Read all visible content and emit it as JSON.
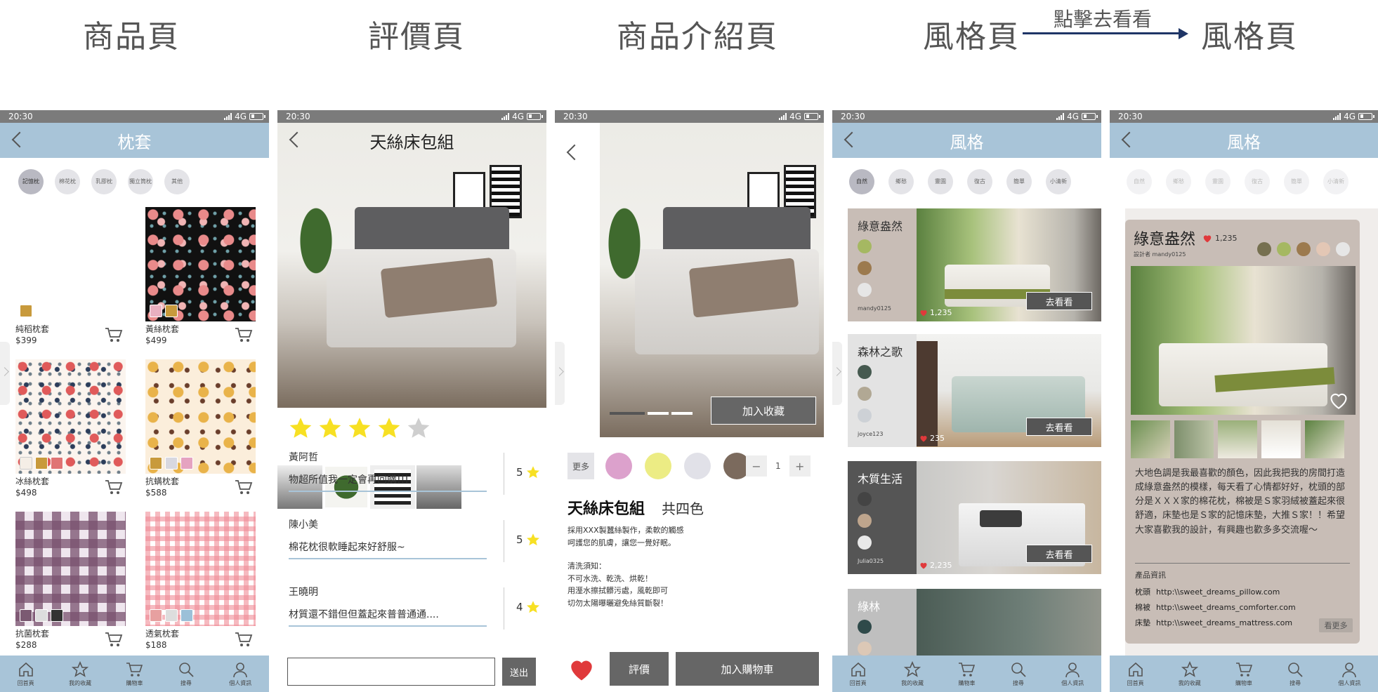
{
  "headers": {
    "product_page": "商品頁",
    "review_page": "評價頁",
    "intro_page": "商品介紹頁",
    "style_page": "風格頁",
    "style_page_2": "風格頁",
    "flow_label": "點擊去看看"
  },
  "status": {
    "time": "20:30",
    "network": "4G"
  },
  "nav": [
    "回首頁",
    "我的收藏",
    "購物車",
    "搜尋",
    "個人資訊"
  ],
  "screen1": {
    "title": "枕套",
    "chips": [
      "記憶枕",
      "棉花枕",
      "乳膠枕",
      "獨立筒枕",
      "其他"
    ],
    "products": [
      {
        "name": "純稻枕套",
        "price": "$399"
      },
      {
        "name": "黃絲枕套",
        "price": "$499"
      },
      {
        "name": "冰絲枕套",
        "price": "$498"
      },
      {
        "name": "抗螨枕套",
        "price": "$588"
      },
      {
        "name": "抗菌枕套",
        "price": "$288"
      },
      {
        "name": "透氣枕套",
        "price": "$188"
      }
    ]
  },
  "screen2": {
    "title": "天絲床包組",
    "rating_stars": 4,
    "reviews": [
      {
        "name": "黃阿哲",
        "text": "物超所值我一定會再回購!!!",
        "score": "5"
      },
      {
        "name": "陳小美",
        "text": "棉花枕很軟睡起來好舒服~",
        "score": "5"
      },
      {
        "name": "王曉明",
        "text": "材質還不錯但但蓋起來普普通通....",
        "score": "4"
      }
    ],
    "send_label": "送出"
  },
  "screen3": {
    "fav_label": "加入收藏",
    "more_label": "更多",
    "colors": [
      "#dca1cc",
      "#ecec84",
      "#e1e1e8",
      "#7b6a5d"
    ],
    "qty": "1",
    "minus": "−",
    "plus": "+",
    "name": "天絲床包組",
    "color_count": "共四色",
    "desc": [
      "採用XXX製蠶絲製作，柔軟的觸感",
      "呵護您的肌膚，讓您一覺好眠。"
    ],
    "wash_title": "清洗須知：",
    "wash": [
      "不可水洗、乾洗、烘乾！",
      "用溼水擦拭髒污處，風乾即可",
      "切勿太陽曝曬避免絲質斷裂！"
    ],
    "review_btn": "評價",
    "cart_btn": "加入購物車"
  },
  "screen4": {
    "title": "風格",
    "chips": [
      "自然",
      "鄉愁",
      "靈園",
      "復古",
      "簡單",
      "小清新"
    ],
    "go_label": "去看看",
    "cards": [
      {
        "name": "綠意盎然",
        "author": "mandy0125",
        "likes": "1,235",
        "dots": [
          "#a5b862",
          "#9c7a4e",
          "#e6e6e6"
        ]
      },
      {
        "name": "森林之歌",
        "author": "joyce123",
        "likes": "235",
        "dots": [
          "#465a50",
          "#b1a894",
          "#cdd1d6"
        ]
      },
      {
        "name": "木質生活",
        "author": "Julia0325",
        "likes": "2,235",
        "dots": [
          "#555555",
          "#bea58d",
          "#e9e9e9"
        ]
      },
      {
        "name": "綠林",
        "author": "",
        "likes": "",
        "dots": [
          "#2f4a4a",
          "#dcc8b6"
        ]
      }
    ]
  },
  "screen5": {
    "title": "風格",
    "chips": [
      "自然",
      "鄉愁",
      "靈園",
      "復古",
      "簡單",
      "小清新"
    ],
    "name": "綠意盎然",
    "likes": "1,235",
    "designer": "設計者 mandy0125",
    "palette": [
      "#767050",
      "#a5b862",
      "#9c7a4e",
      "#e3c7b5",
      "#e6e6e6"
    ],
    "desc": "大地色調是我最喜歡的顏色，因此我把我的房間打造成綠意盎然的模樣，每天看了心情都好好，枕頭的部分是ＸＸＸ家的棉花枕，棉被是Ｓ家羽絨被蓋起來很舒適，床墊也是Ｓ家的記憶床墊，大推Ｓ家！！希望大家喜歡我的設計，有興趣也歡多多交流喔～",
    "info_title": "產品資訊",
    "links": [
      {
        "label": "枕頭",
        "url": "http:\\\\sweet_dreams_pillow.com"
      },
      {
        "label": "棉被",
        "url": "http:\\\\sweet_dreams_comforter.com"
      },
      {
        "label": "床墊",
        "url": "http:\\\\sweet_dreams_mattress.com"
      }
    ],
    "more_label": "看更多"
  }
}
